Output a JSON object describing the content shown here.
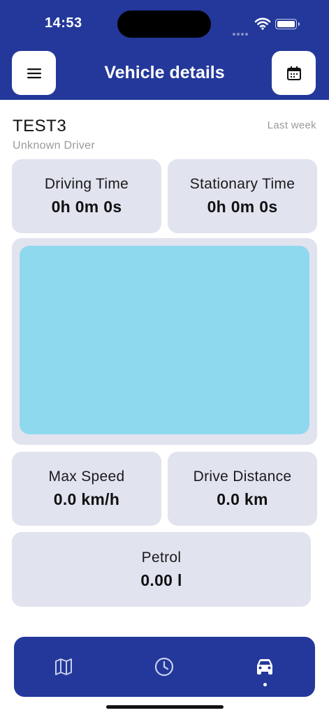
{
  "status_bar": {
    "time": "14:53"
  },
  "header": {
    "title": "Vehicle details",
    "menu_icon": "hamburger-menu-icon",
    "calendar_icon": "calendar-icon",
    "background": "#23389a"
  },
  "vehicle": {
    "name": "TEST3",
    "driver": "Unknown Driver",
    "period": "Last week"
  },
  "stats": {
    "driving_time": {
      "label": "Driving Time",
      "value": "0h 0m 0s"
    },
    "stationary_time": {
      "label": "Stationary Time",
      "value": "0h 0m 0s"
    },
    "max_speed": {
      "label": "Max Speed",
      "value": "0.0 km/h"
    },
    "drive_distance": {
      "label": "Drive Distance",
      "value": "0.0 km"
    },
    "petrol": {
      "label": "Petrol",
      "value": "0.00 l"
    }
  },
  "map": {
    "fill_color": "#8fd9ee"
  },
  "bottom_nav": {
    "items": [
      {
        "icon": "map-icon",
        "active": false
      },
      {
        "icon": "clock-icon",
        "active": false
      },
      {
        "icon": "car-icon",
        "active": true
      }
    ],
    "background": "#23389a"
  },
  "colors": {
    "card_background": "#e1e3ef",
    "muted_text": "#9a9a9a"
  }
}
